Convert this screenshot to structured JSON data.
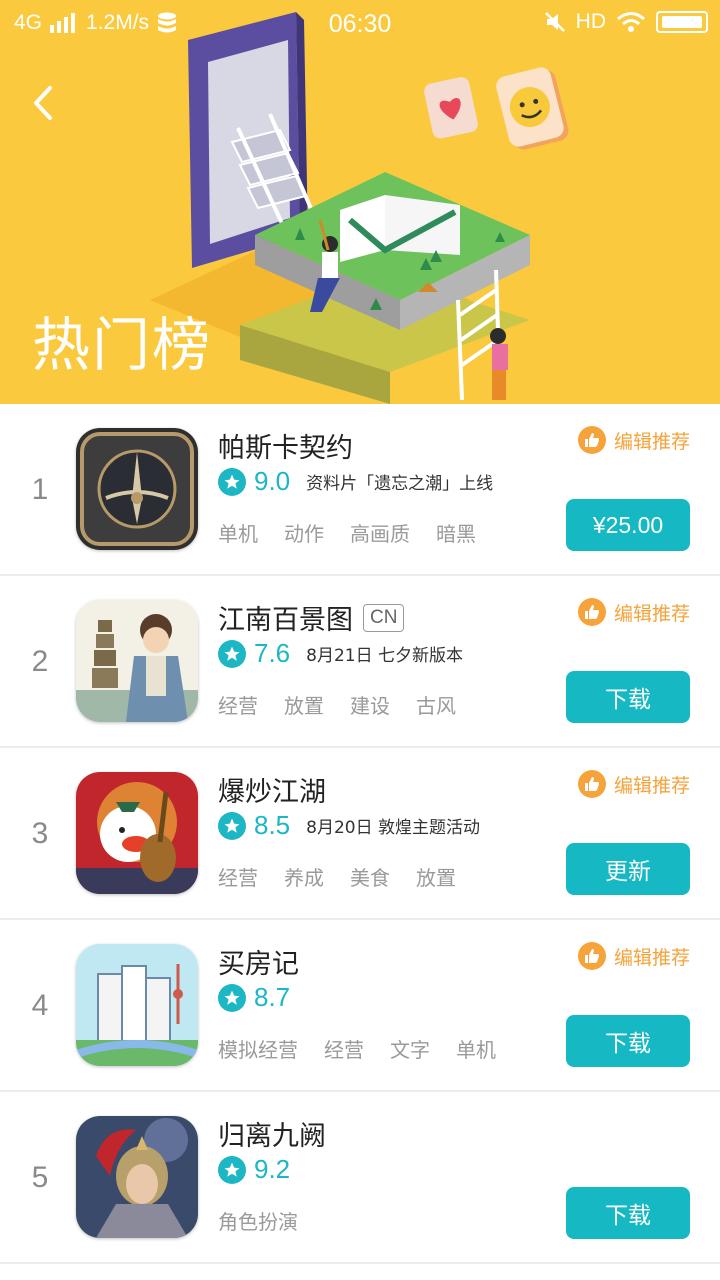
{
  "status_bar": {
    "network": "4G",
    "speed": "1.2M/s",
    "time": "06:30",
    "hd": "HD"
  },
  "header": {
    "title": "热门榜",
    "back_icon": "chevron-left-icon"
  },
  "colors": {
    "banner_bg": "#fbc93e",
    "accent": "#1cb6c5",
    "button": "#16b9c3",
    "recommend": "#f5a33a"
  },
  "apps": [
    {
      "rank": "1",
      "name": "帕斯卡契约",
      "badge": "",
      "score": "9.0",
      "desc": "资料片「遗忘之潮」上线",
      "tags": [
        "单机",
        "动作",
        "高画质",
        "暗黑"
      ],
      "recommend": "编辑推荐",
      "action": "¥25.00"
    },
    {
      "rank": "2",
      "name": "江南百景图",
      "badge": "CN",
      "score": "7.6",
      "desc": "8月21日 七夕新版本",
      "tags": [
        "经营",
        "放置",
        "建设",
        "古风"
      ],
      "recommend": "编辑推荐",
      "action": "下载"
    },
    {
      "rank": "3",
      "name": "爆炒江湖",
      "badge": "",
      "score": "8.5",
      "desc": "8月20日 敦煌主题活动",
      "tags": [
        "经营",
        "养成",
        "美食",
        "放置"
      ],
      "recommend": "编辑推荐",
      "action": "更新"
    },
    {
      "rank": "4",
      "name": "买房记",
      "badge": "",
      "score": "8.7",
      "desc": "",
      "tags": [
        "模拟经营",
        "经营",
        "文字",
        "单机"
      ],
      "recommend": "编辑推荐",
      "action": "下载"
    },
    {
      "rank": "5",
      "name": "归离九阙",
      "badge": "",
      "score": "9.2",
      "desc": "",
      "tags": [
        "角色扮演"
      ],
      "recommend": "",
      "action": "下载"
    }
  ]
}
